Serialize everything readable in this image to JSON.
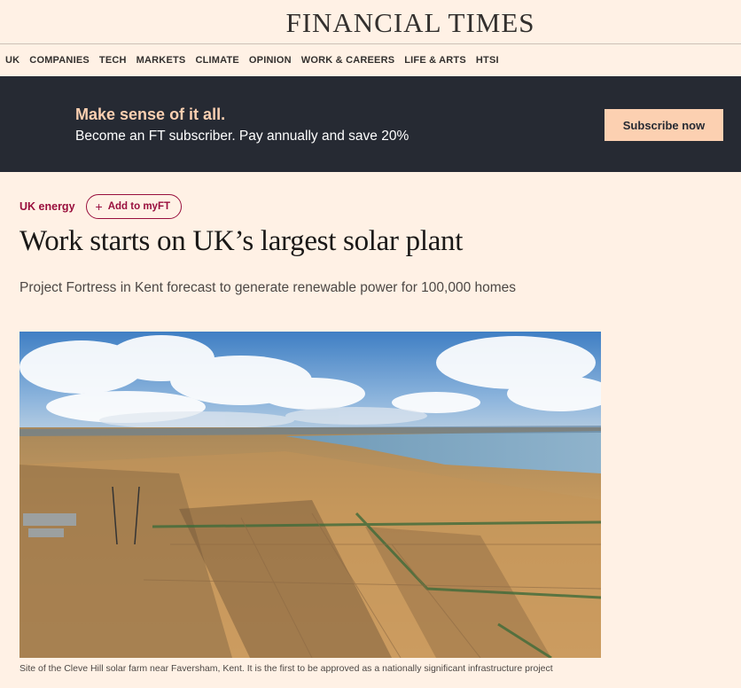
{
  "masthead": {
    "brand": "FINANCIAL TIMES"
  },
  "nav": {
    "items": [
      "UK",
      "COMPANIES",
      "TECH",
      "MARKETS",
      "CLIMATE",
      "OPINION",
      "WORK & CAREERS",
      "LIFE & ARTS",
      "HTSI"
    ]
  },
  "promo": {
    "headline": "Make sense of it all.",
    "subtext": "Become an FT subscriber. Pay annually and save 20%",
    "cta_label": "Subscribe now"
  },
  "article": {
    "topic": "UK energy",
    "myft_label": "Add to myFT",
    "title": "Work starts on UK’s largest solar plant",
    "standfirst": "Project Fortress in Kent forecast to generate renewable power for 100,000 homes",
    "image_caption": "Site of the Cleve Hill solar farm near Faversham, Kent. It is the first to be approved as a nationally significant infrastructure project"
  },
  "colors": {
    "background": "#fff1e5",
    "promo_bg": "#262a33",
    "promo_accent": "#fcd0b1",
    "topic": "#990f3d"
  }
}
